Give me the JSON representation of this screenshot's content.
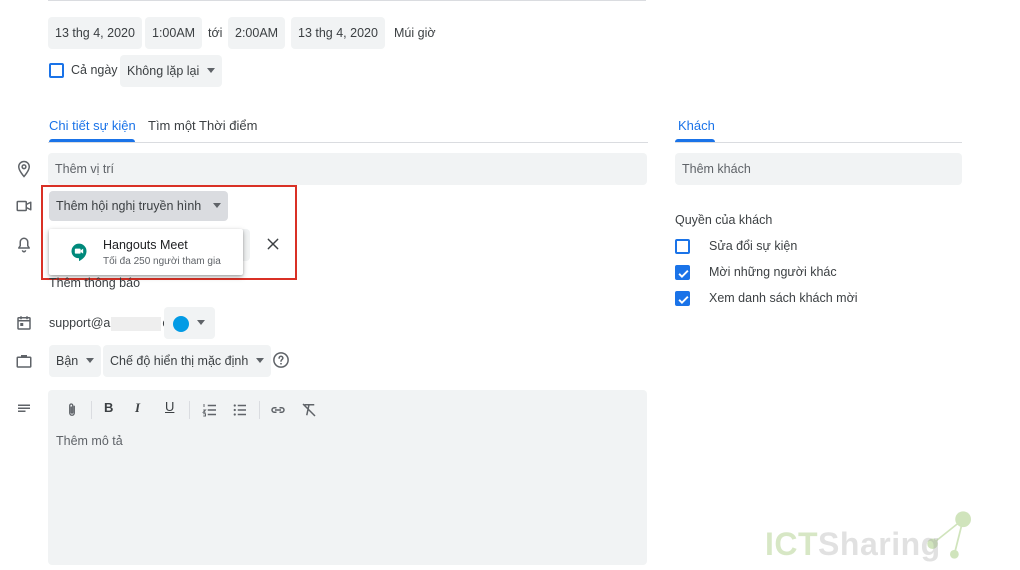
{
  "datetime": {
    "start_date": "13 thg 4, 2020",
    "start_time": "1:00AM",
    "to": "tới",
    "end_time": "2:00AM",
    "end_date": "13 thg 4, 2020",
    "timezone": "Múi giờ"
  },
  "all_day": {
    "label": "Cả ngày",
    "checked": false
  },
  "repeat": {
    "value": "Không lặp lại"
  },
  "tabs": {
    "details": "Chi tiết sự kiện",
    "find_time": "Tìm một Thời điểm",
    "guests": "Khách"
  },
  "location": {
    "placeholder": "Thêm vị trí"
  },
  "conference": {
    "button": "Thêm hội nghị truyền hình"
  },
  "dropdown": {
    "title": "Hangouts Meet",
    "subtitle": "Tối đa 250 người tham gia"
  },
  "notification": {
    "add": "Thêm thông báo"
  },
  "calendar": {
    "email_prefix": "support@a",
    "email_suffix": "com",
    "color": "#039be5"
  },
  "availability": {
    "value": "Bận"
  },
  "visibility": {
    "value": "Chế độ hiển thị mặc định"
  },
  "description": {
    "placeholder": "Thêm mô tả"
  },
  "guests": {
    "placeholder": "Thêm khách",
    "permissions_title": "Quyền của khách",
    "permissions": [
      {
        "label": "Sửa đổi sự kiện",
        "checked": false
      },
      {
        "label": "Mời những người khác",
        "checked": true
      },
      {
        "label": "Xem danh sách khách mời",
        "checked": true
      }
    ]
  },
  "watermark": {
    "part1": "ICT",
    "part2": "Sharing"
  },
  "colors": {
    "accent": "#1a73e8",
    "highlight_box": "#d93025",
    "field_bg": "#f1f3f4"
  }
}
